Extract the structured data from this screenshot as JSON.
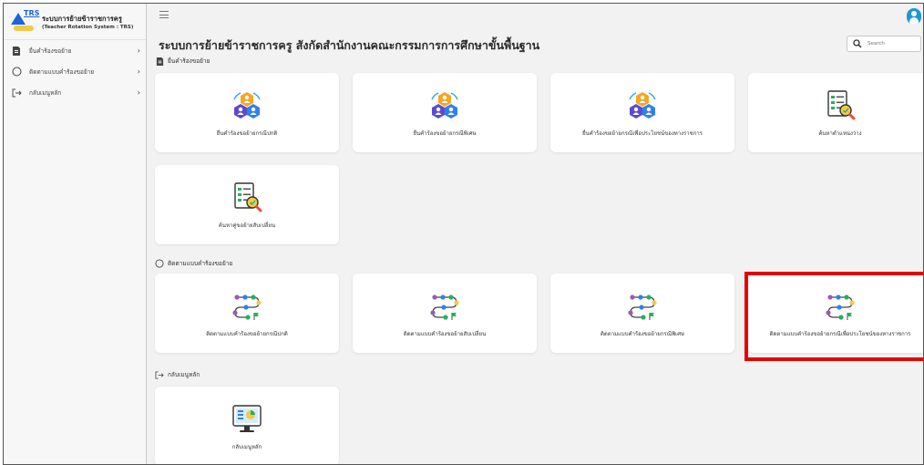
{
  "app": {
    "abbr": "TRS",
    "title": "ระบบการย้ายข้าราชการครู",
    "subtitle": "(Teacher Rotation System : TRS)"
  },
  "sidebar": {
    "items": [
      {
        "label": "ยื่นคำร้องขอย้าย",
        "icon": "file-icon"
      },
      {
        "label": "ติดตามแบบคำร้องขอย้าย",
        "icon": "search-circle-icon"
      },
      {
        "label": "กลับเมนูหลัก",
        "icon": "arrow-right-icon"
      }
    ]
  },
  "header": {
    "page_title": "ระบบการย้ายข้าราชการครู สังกัดสำนักงานคณะกรรมการการศึกษาขั้นพื้นฐาน",
    "search_placeholder": "Search"
  },
  "sections": {
    "submit": {
      "title": "ยื่นคำร้องขอย้าย",
      "cards": [
        {
          "label": "ยื่นคำร้องขอย้ายกรณีปกติ",
          "icon": "people-hexagon-icon"
        },
        {
          "label": "ยื่นคำร้องขอย้ายกรณีพิเศษ",
          "icon": "people-hexagon-icon"
        },
        {
          "label": "ยื่นคำร้องขอย้ายกรณีเพื่อประโยชน์ของทางราชการ",
          "icon": "people-hexagon-icon"
        },
        {
          "label": "ค้นหาตำแหน่งว่าง",
          "icon": "document-search-icon"
        },
        {
          "label": "ค้นหาคู่ขอย้ายสับเปลี่ยน",
          "icon": "document-search-icon"
        }
      ]
    },
    "track": {
      "title": "ติดตามแบบคำร้องขอย้าย",
      "cards": [
        {
          "label": "ติดตามแบบคำร้องขอย้ายกรณีปกติ",
          "icon": "route-icon"
        },
        {
          "label": "ติดตามแบบคำร้องขอย้ายสับเปลี่ยน",
          "icon": "route-icon"
        },
        {
          "label": "ติดตามแบบคำร้องขอย้ายกรณีพิเศษ",
          "icon": "route-icon"
        },
        {
          "label": "ติดตามแบบคำร้องขอย้ายกรณีเพื่อประโยชน์ของทางราชการ",
          "icon": "route-icon"
        }
      ]
    },
    "back": {
      "title": "กลับเมนูหลัก",
      "cards": [
        {
          "label": "กลับเมนูหลัก",
          "icon": "monitor-chart-icon"
        }
      ]
    }
  },
  "colors": {
    "accent": "#1e64d6",
    "highlight": "#e60000",
    "avatar": "#1e96d6"
  }
}
